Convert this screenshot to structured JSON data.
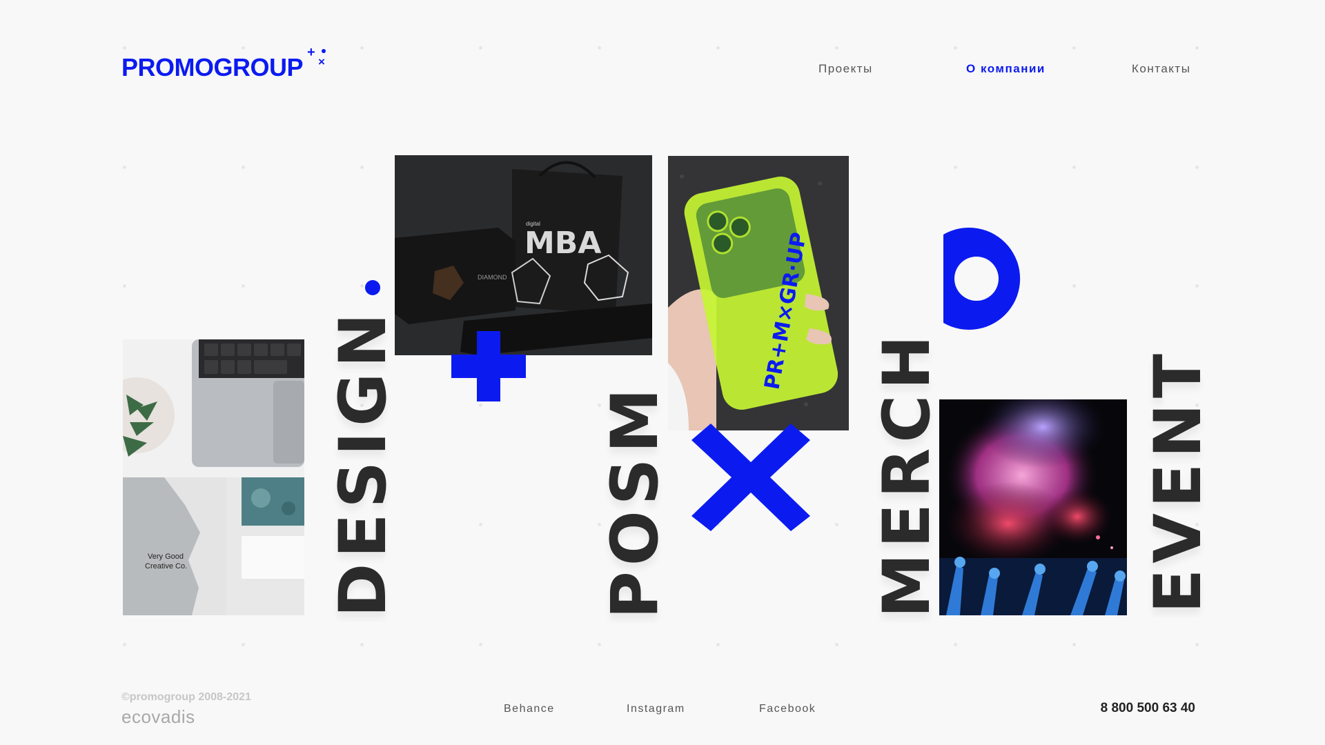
{
  "brand": {
    "logo_text": "PROMOGROUP",
    "accent_color": "#0b1bf0"
  },
  "nav": {
    "items": [
      {
        "label": "Проекты",
        "active": false
      },
      {
        "label": "О компании",
        "active": true
      },
      {
        "label": "Контакты",
        "active": false
      }
    ]
  },
  "hero": {
    "words": [
      "DESIGN",
      "POSM",
      "MERCH",
      "EVENT"
    ],
    "photos": {
      "design_card": {
        "text_line1": "Very Good",
        "text_line2": "Creative Co."
      },
      "mba_box": {
        "label_small": "digital",
        "label_big": "MBA",
        "brand": "DIAMOND"
      },
      "phone_case": {
        "text": "PR+M×GR·UP"
      }
    }
  },
  "footer": {
    "copyright": "©promogroup 2008-2021",
    "partner": "ecovadis",
    "social": [
      "Behance",
      "Instagram",
      "Facebook"
    ],
    "phone": "8 800 500 63 40"
  }
}
